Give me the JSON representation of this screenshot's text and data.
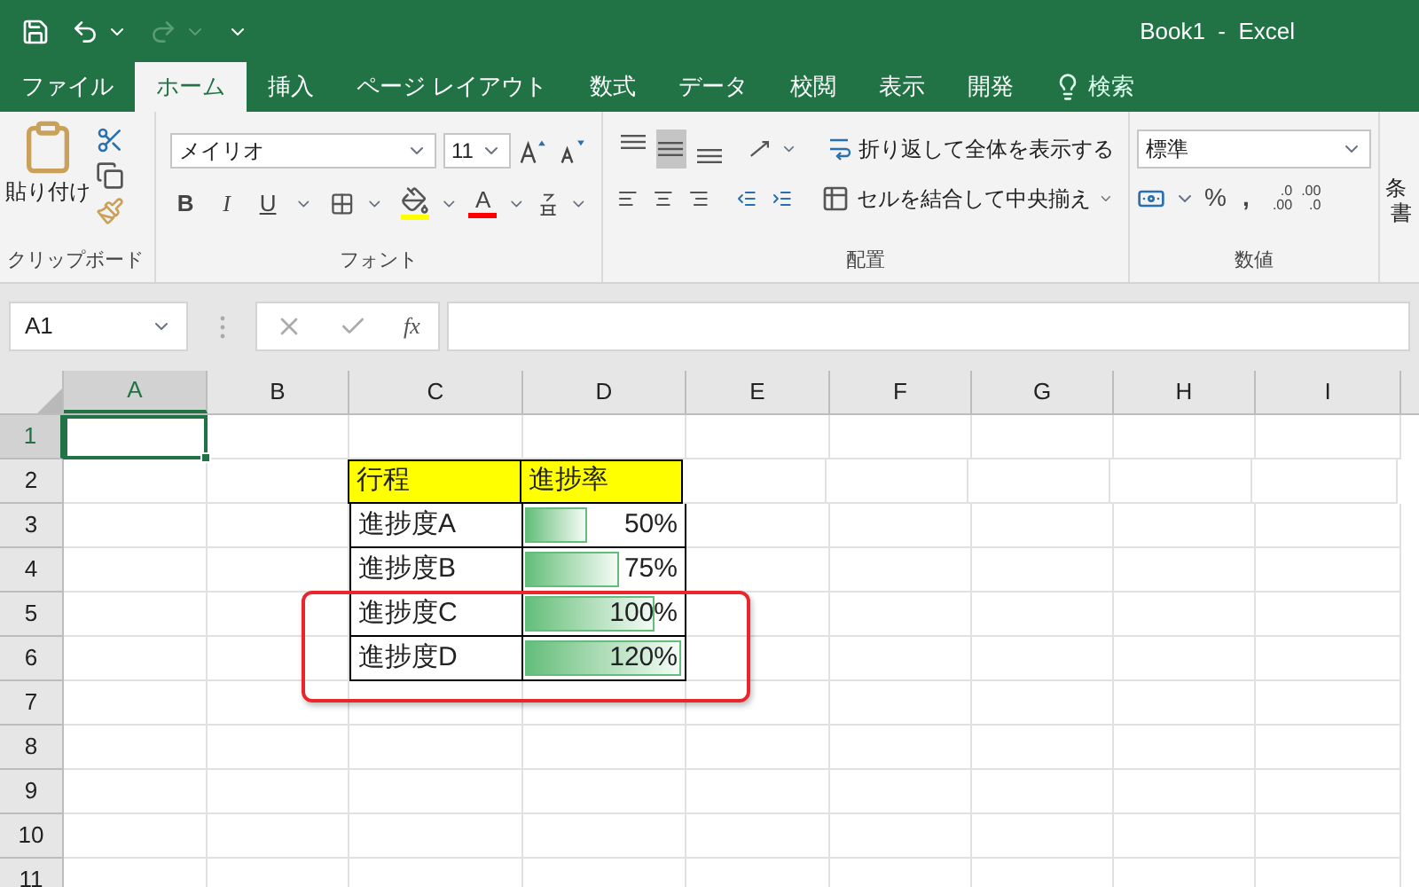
{
  "title_bar": {
    "title": "Book1  -  Excel",
    "redo_enabled": false
  },
  "tabs": [
    {
      "label": "ファイル",
      "selected": false
    },
    {
      "label": "ホーム",
      "selected": true
    },
    {
      "label": "挿入",
      "selected": false
    },
    {
      "label": "ページ レイアウト",
      "selected": false
    },
    {
      "label": "数式",
      "selected": false
    },
    {
      "label": "データ",
      "selected": false
    },
    {
      "label": "校閲",
      "selected": false
    },
    {
      "label": "表示",
      "selected": false
    },
    {
      "label": "開発",
      "selected": false
    }
  ],
  "tell_me": {
    "label": "検索"
  },
  "ribbon": {
    "clipboard": {
      "paste": "貼り付け",
      "group": "クリップボード"
    },
    "font": {
      "name": "メイリオ",
      "size": "11",
      "bold": "B",
      "italic": "I",
      "underline": "U",
      "font_color": "A",
      "group": "フォント"
    },
    "alignment": {
      "vertical": [
        {
          "kind": "top",
          "selected": false
        },
        {
          "kind": "middle",
          "selected": true
        },
        {
          "kind": "bottom",
          "selected": false
        }
      ],
      "wrap": "折り返して全体を表示する",
      "merge": "セルを結合して中央揃え",
      "group": "配置"
    },
    "number": {
      "format": "標準",
      "percent": "%",
      "comma": ",",
      "decimal_more": ".0",
      "decimal_more_2": ".00",
      "decimal_less": ".00",
      "decimal_less_2": ".0",
      "group": "数値"
    },
    "styles": {
      "label_1": "条",
      "label_2": "書"
    }
  },
  "name_box": "A1",
  "formula_bar": {
    "fx": "fx"
  },
  "columns": [
    "A",
    "B",
    "C",
    "D",
    "E",
    "F",
    "G",
    "H",
    "I"
  ],
  "row_numbers": [
    "1",
    "2",
    "3",
    "4",
    "5",
    "6",
    "7",
    "8",
    "9",
    "10",
    "11"
  ],
  "table": {
    "header": [
      "行程",
      "進捗率"
    ],
    "rows": [
      {
        "name": "進捗度A",
        "value": "50%",
        "level": 0.42
      },
      {
        "name": "進捗度B",
        "value": "75%",
        "level": 0.62
      },
      {
        "name": "進捗度C",
        "value": "100%",
        "level": 0.83
      },
      {
        "name": "進捗度D",
        "value": "120%",
        "level": 1
      }
    ]
  }
}
